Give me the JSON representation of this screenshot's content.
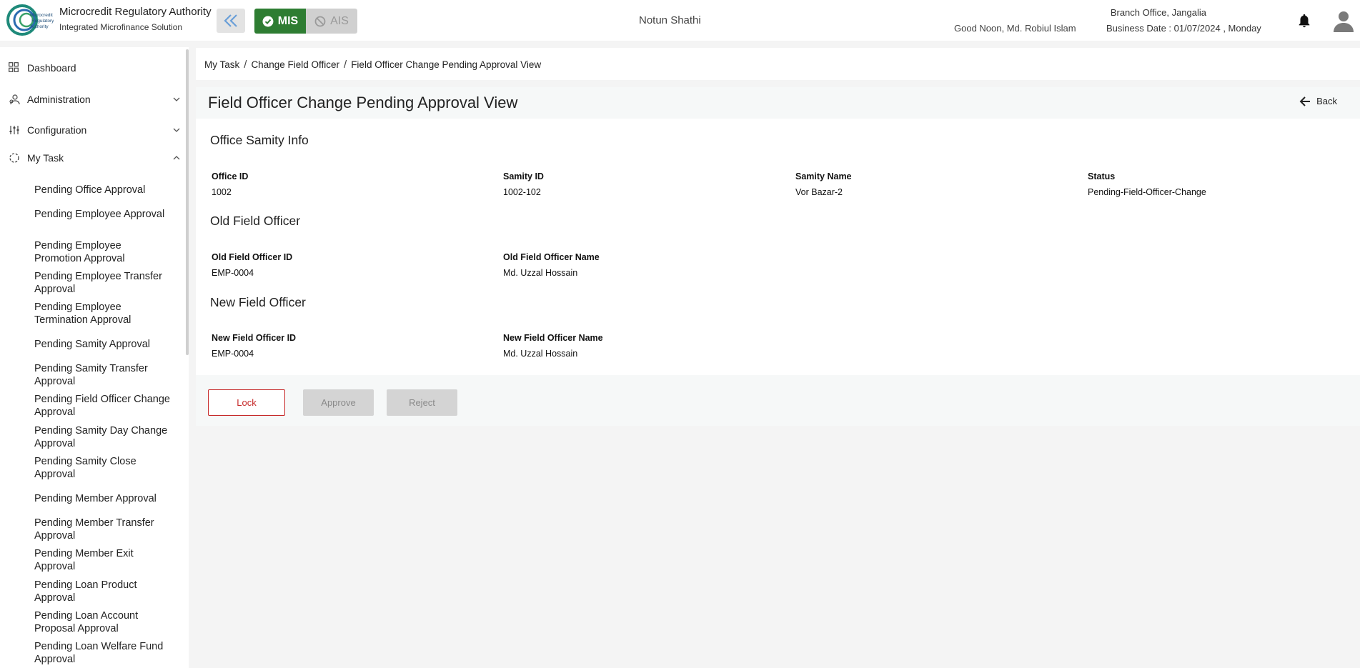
{
  "header": {
    "org_title": "Microcredit Regulatory Authority",
    "org_subtitle": "Integrated Microfinance Solution",
    "logo_text": "Microcredit Regulatory Authority",
    "mis_label": "MIS",
    "ais_label": "AIS",
    "app_name": "Notun Shathi",
    "greeting": "Good Noon, Md. Robiul Islam",
    "branch": "Branch Office, Jangalia",
    "business_date": "Business Date : 01/07/2024 , Monday",
    "icons": [
      "double-chevron-left-icon",
      "check-circle-icon",
      "ban-icon",
      "bell-icon",
      "user-avatar-icon"
    ]
  },
  "sidebar": {
    "main_items": [
      {
        "label": "Dashboard",
        "icon": "grid-icon"
      },
      {
        "label": "Administration",
        "icon": "admin-icon"
      },
      {
        "label": "Configuration",
        "icon": "sliders-icon"
      },
      {
        "label": "My Task",
        "icon": "task-circle-icon"
      }
    ],
    "sub_items": [
      "Pending Office Approval",
      "Pending Employee Approval",
      "Pending Employee Promotion Approval",
      "Pending Employee Transfer Approval",
      "Pending Employee Termination Approval",
      "Pending Samity Approval",
      "Pending Samity Transfer Approval",
      "Pending Field Officer Change Approval",
      "Pending Samity Day Change Approval",
      "Pending Samity Close Approval",
      "Pending Member Approval",
      "Pending Member Transfer Approval",
      "Pending Member Exit Approval",
      "Pending Loan Product Approval",
      "Pending Loan Account Proposal Approval",
      "Pending Loan Welfare Fund Approval"
    ]
  },
  "breadcrumb": {
    "items": [
      "My Task",
      "Change Field Officer",
      "Field Officer Change Pending Approval View"
    ],
    "separator": "/"
  },
  "page": {
    "title": "Field Officer Change Pending Approval View",
    "back_label": "Back"
  },
  "office_samity": {
    "title": "Office Samity Info",
    "office_id_label": "Office ID",
    "office_id": "1002",
    "samity_id_label": "Samity ID",
    "samity_id": "1002-102",
    "samity_name_label": "Samity Name",
    "samity_name": "Vor Bazar-2",
    "status_label": "Status",
    "status": "Pending-Field-Officer-Change"
  },
  "old_officer": {
    "title": "Old Field Officer",
    "id_label": "Old Field Officer ID",
    "id": "EMP-0004",
    "name_label": "Old Field Officer Name",
    "name": "Md. Uzzal Hossain"
  },
  "new_officer": {
    "title": "New Field Officer",
    "id_label": "New Field Officer ID",
    "id": "EMP-0004",
    "name_label": "New Field Officer Name",
    "name": "Md. Uzzal Hossain"
  },
  "actions": {
    "lock": "Lock",
    "approve": "Approve",
    "reject": "Reject"
  },
  "colors": {
    "mis_green": "#2e7d32",
    "lock_red": "#c62828",
    "disabled_gray": "#d4d4d4",
    "logo_teal": "#1f8a7a"
  }
}
